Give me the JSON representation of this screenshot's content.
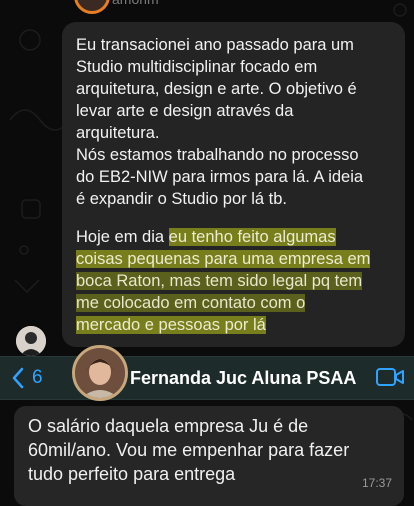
{
  "top": {
    "sender_partial": "amorim"
  },
  "incoming_message": {
    "paragraph1": [
      "Eu transacionei ano passado para um",
      "Studio multidisciplinar focado em",
      "arquitetura, design e arte. O objetivo é",
      "levar arte e design através da",
      "arquitetura."
    ],
    "paragraph1_line6": "Nós estamos trabalhando no processo",
    "paragraph1_line7": "do EB2-NIW para irmos para lá. A ideia",
    "paragraph1_line8": "é expandir o Studio por lá tb.",
    "p2_l1_plain": "Hoje em dia ",
    "p2_l1_hl": "eu tenho feito algumas",
    "p2_l2_hl": "coisas pequenas para uma empresa em",
    "p2_l3_hl": "boca Raton, mas tem sido legal pq tem",
    "p2_l4_hl": "me colocado em contato com o",
    "p2_l5_hl": "mercado e pessoas por lá"
  },
  "header": {
    "back_count": "6",
    "contact_name": "Fernanda Juc Aluna PSAA",
    "accent_color": "#2fa3ff"
  },
  "outgoing_message": {
    "lines": [
      "O salário daquela empresa Ju é de",
      "60mil/ano. Vou me empenhar para fazer",
      "tudo perfeito para entrega"
    ],
    "time": "17:37"
  }
}
